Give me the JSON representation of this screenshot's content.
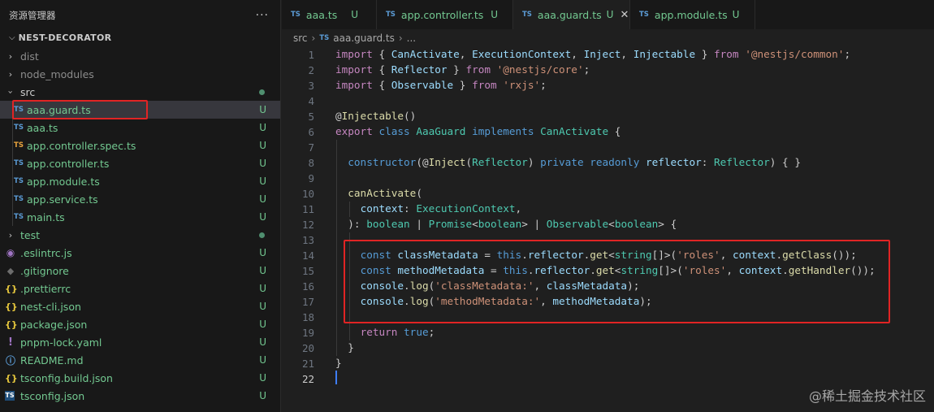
{
  "sidebar": {
    "title": "资源管理器",
    "more": "···",
    "project": "NEST-DECORATOR",
    "items": [
      {
        "label": "dist",
        "type": "folder",
        "expanded": false,
        "status": "",
        "dot": false
      },
      {
        "label": "node_modules",
        "type": "folder",
        "expanded": false,
        "status": "",
        "dot": false
      },
      {
        "label": "src",
        "type": "folder",
        "expanded": true,
        "status": "",
        "dot": true
      },
      {
        "label": "aaa.guard.ts",
        "type": "ts",
        "status": "U",
        "selected": true
      },
      {
        "label": "aaa.ts",
        "type": "ts",
        "status": "U"
      },
      {
        "label": "app.controller.spec.ts",
        "type": "ts-spec",
        "status": "U"
      },
      {
        "label": "app.controller.ts",
        "type": "ts",
        "status": "U"
      },
      {
        "label": "app.module.ts",
        "type": "ts",
        "status": "U"
      },
      {
        "label": "app.service.ts",
        "type": "ts",
        "status": "U"
      },
      {
        "label": "main.ts",
        "type": "ts",
        "status": "U"
      },
      {
        "label": "test",
        "type": "folder",
        "expanded": false,
        "status": "",
        "dot": true
      },
      {
        "label": ".eslintrc.js",
        "type": "eslint",
        "status": "U"
      },
      {
        "label": ".gitignore",
        "type": "git",
        "status": "U"
      },
      {
        "label": ".prettierrc",
        "type": "json",
        "status": "U"
      },
      {
        "label": "nest-cli.json",
        "type": "json",
        "status": "U"
      },
      {
        "label": "package.json",
        "type": "json",
        "status": "U"
      },
      {
        "label": "pnpm-lock.yaml",
        "type": "yaml",
        "status": "U"
      },
      {
        "label": "README.md",
        "type": "info",
        "status": "U"
      },
      {
        "label": "tsconfig.build.json",
        "type": "json",
        "status": "U"
      },
      {
        "label": "tsconfig.json",
        "type": "tsconfig",
        "status": "U"
      }
    ]
  },
  "tabs": [
    {
      "label": "aaa.ts",
      "status": "U",
      "active": false
    },
    {
      "label": "app.controller.ts",
      "status": "U",
      "active": false
    },
    {
      "label": "aaa.guard.ts",
      "status": "U",
      "active": true,
      "close": "✕"
    },
    {
      "label": "app.module.ts",
      "status": "U",
      "active": false
    }
  ],
  "breadcrumb": {
    "folder": "src",
    "sep": "›",
    "file": "aaa.guard.ts",
    "more": "..."
  },
  "icons": {
    "ts_badge": "TS"
  },
  "editor": {
    "line_numbers": [
      "1",
      "2",
      "3",
      "4",
      "5",
      "6",
      "7",
      "8",
      "9",
      "10",
      "11",
      "12",
      "13",
      "14",
      "15",
      "16",
      "17",
      "18",
      "19",
      "20",
      "21",
      "22"
    ],
    "current_line": "22"
  },
  "watermark": "@稀土掘金技术社区",
  "colors": {
    "accent": "#3e7df5",
    "untracked": "#73c991",
    "highlight_box": "#e02424"
  }
}
